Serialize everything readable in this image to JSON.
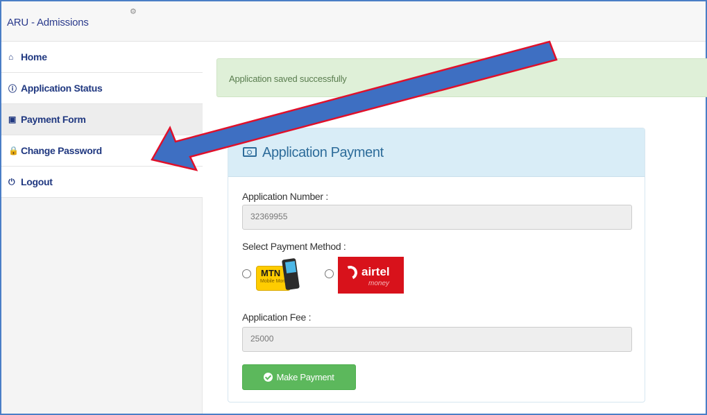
{
  "header": {
    "brand": "ARU - Admissions"
  },
  "sidebar": {
    "items": [
      {
        "label": "Home",
        "icon": "home-icon",
        "glyph": "⌂"
      },
      {
        "label": "Application Status",
        "icon": "info-circle-icon",
        "glyph": "ℹ"
      },
      {
        "label": "Payment Form",
        "icon": "money-icon",
        "glyph": "▣"
      },
      {
        "label": "Change Password",
        "icon": "lock-icon",
        "glyph": "■"
      },
      {
        "label": "Logout",
        "icon": "power-icon",
        "glyph": "⏻"
      }
    ]
  },
  "alert": {
    "message": "Application saved successfully"
  },
  "payment": {
    "title": "Application Payment",
    "application_number_label": "Application Number",
    "application_number": "32369955",
    "method_label": "Select Payment Method",
    "methods": [
      {
        "name": "MTN",
        "sub": "Mobile Money"
      },
      {
        "name": "airtel",
        "sub": "money"
      }
    ],
    "fee_label": "Application Fee",
    "fee": "25000",
    "submit_label": "Make Payment"
  },
  "colors": {
    "accent": "#2a3a8c",
    "success_alert_bg": "#dff0d8",
    "panel_head_bg": "#d9edf7",
    "button": "#5cb85c",
    "annotation_arrow_fill": "#3e6fc2",
    "annotation_arrow_stroke": "#e0102a"
  }
}
